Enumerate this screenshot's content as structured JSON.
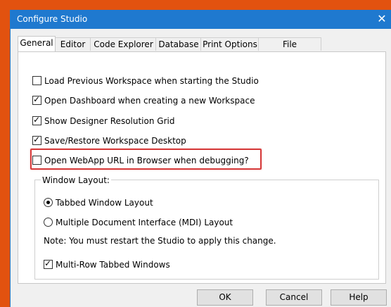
{
  "window": {
    "title": "Configure Studio",
    "close_glyph": "✕"
  },
  "tabs": [
    {
      "label": "General"
    },
    {
      "label": "Editor"
    },
    {
      "label": "Code Explorer"
    },
    {
      "label": "Database"
    },
    {
      "label": "Print Options"
    },
    {
      "label": "File Extensions"
    }
  ],
  "general": {
    "options": [
      {
        "label": "Load Previous Workspace when starting the Studio",
        "checked": false
      },
      {
        "label": "Open Dashboard when creating a new Workspace",
        "checked": true
      },
      {
        "label": "Show Designer Resolution Grid",
        "checked": true
      },
      {
        "label": "Save/Restore Workspace Desktop",
        "checked": true
      },
      {
        "label": "Open WebApp URL in Browser when debugging?",
        "checked": false
      }
    ],
    "window_layout": {
      "legend": "Window Layout:",
      "radios": [
        {
          "label": "Tabbed Window Layout",
          "selected": true
        },
        {
          "label": "Multiple Document Interface (MDI) Layout",
          "selected": false
        }
      ],
      "note": "Note: You must restart the Studio to apply this change.",
      "multi_row": {
        "label": "Multi-Row Tabbed Windows",
        "checked": true
      }
    }
  },
  "buttons": {
    "ok": "OK",
    "cancel": "Cancel",
    "help": "Help"
  },
  "colors": {
    "titlebar": "#1f79cf",
    "highlight": "#d63b3b",
    "desktop": "#e2520f"
  }
}
